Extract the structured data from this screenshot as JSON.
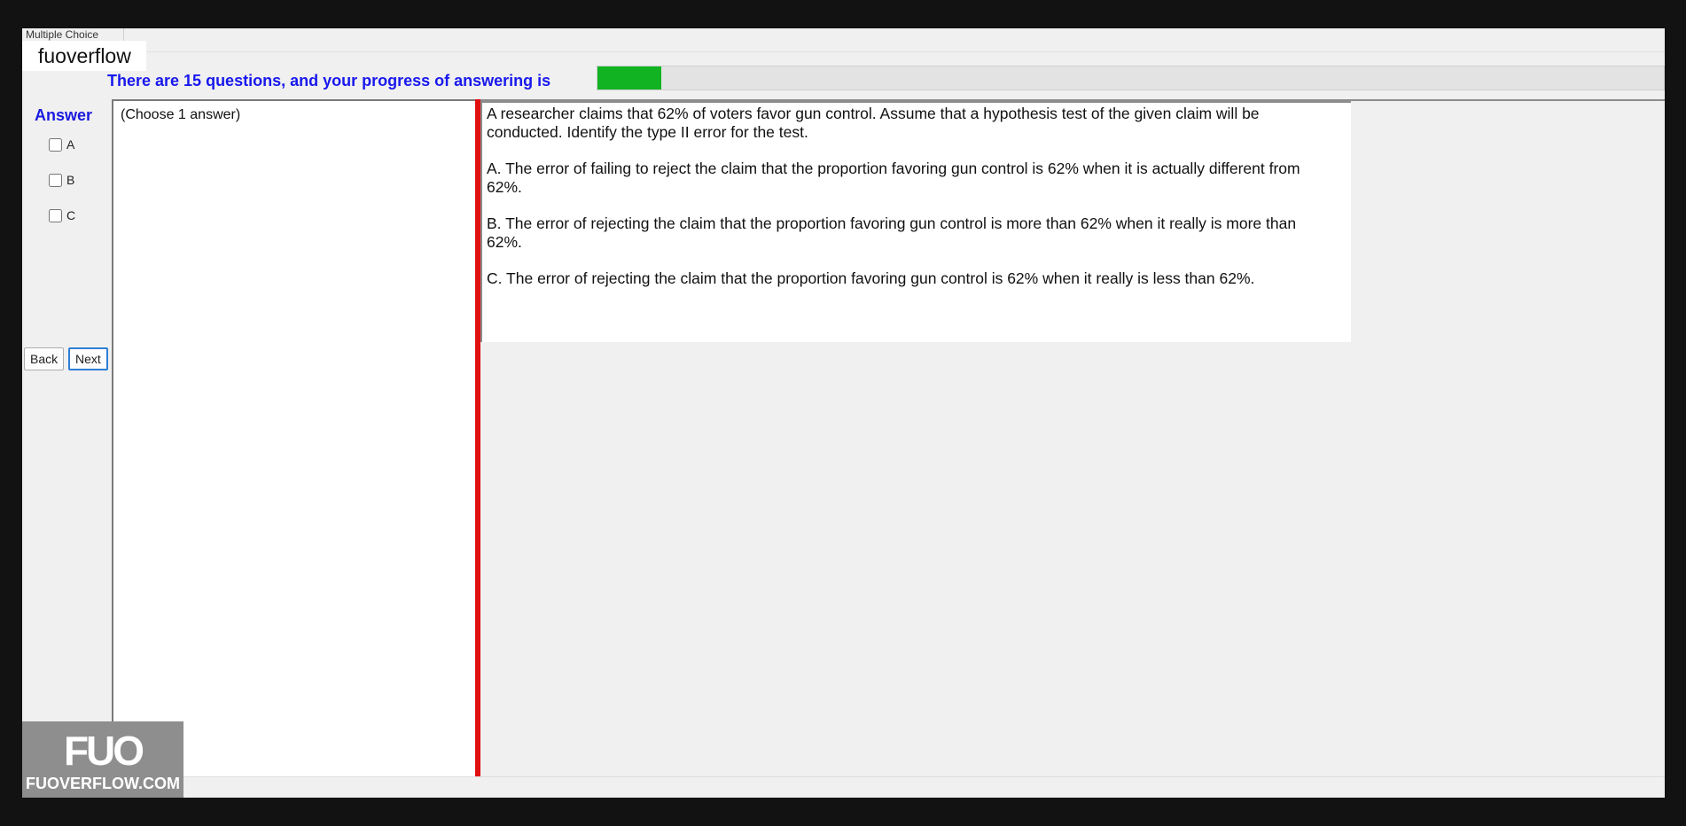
{
  "window": {
    "title_tab": "Multiple Choice"
  },
  "site_label": "fuoverflow",
  "progress": {
    "text": "There are 15 questions, and your progress of answering is",
    "fraction": 0.06,
    "fill_color": "#11b322"
  },
  "answer_panel": {
    "title": "Answer",
    "options": [
      "A",
      "B",
      "C"
    ],
    "back_label": "Back",
    "next_label": "Next"
  },
  "choose_hint": "(Choose 1 answer)",
  "question": {
    "stem": "A researcher claims that 62% of voters favor gun control. Assume that a hypothesis test of the given claim will be conducted. Identify the type II error for the test.",
    "choices": [
      "A.  The error of failing to reject the claim that the proportion favoring gun control is 62% when it is actually different from 62%.",
      "B.  The error of rejecting the claim that the proportion favoring gun control is more than 62% when it really is more than 62%.",
      "C.  The error of rejecting the claim that the proportion favoring gun control is 62% when it really is less than 62%."
    ]
  },
  "watermark": {
    "mark": "FUO",
    "text": "FUOVERFLOW.COM"
  },
  "colors": {
    "accent_blue": "#1818ee",
    "divider_red": "#e11010"
  }
}
